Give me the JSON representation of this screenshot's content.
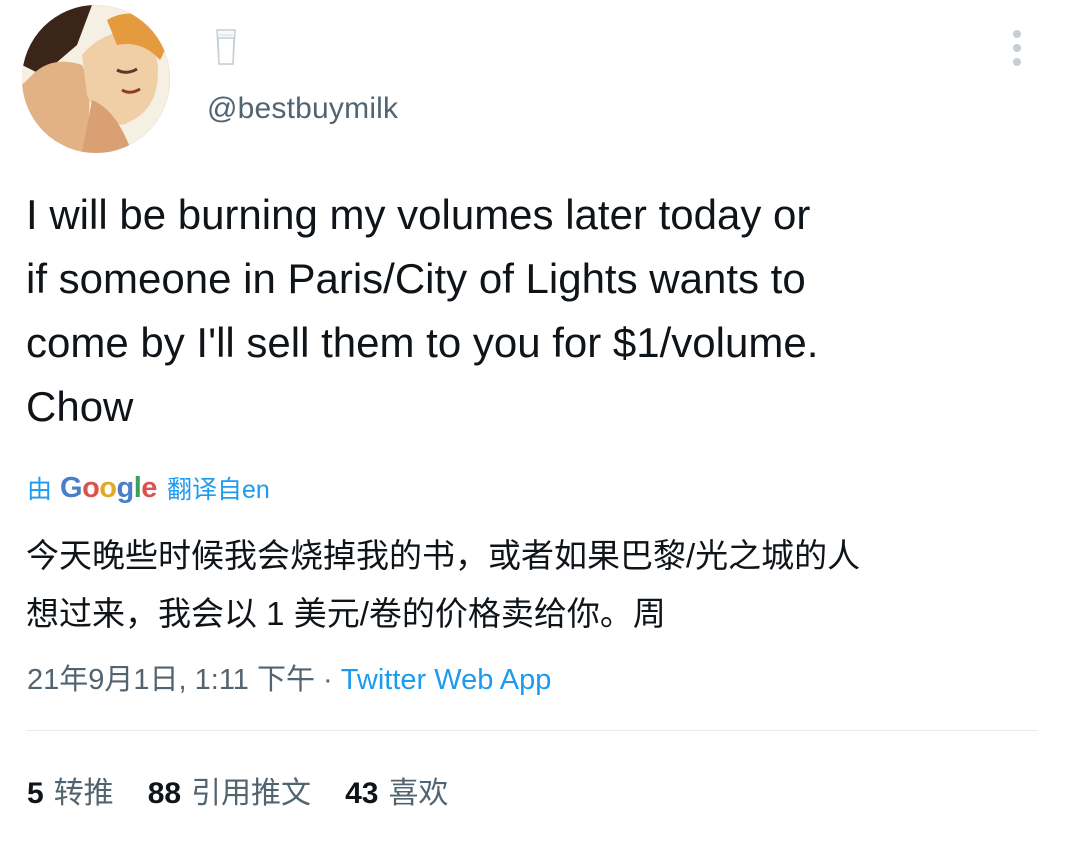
{
  "user": {
    "handle": "@bestbuymilk",
    "name_icon": "milk-glass-icon",
    "avatar": "avatar-image"
  },
  "tweet": {
    "lines": [
      "I will be burning my volumes later today or",
      "if someone in Paris/City of Lights wants to",
      "come by I'll sell them to you for $1/volume.",
      "Chow"
    ]
  },
  "translation": {
    "by_prefix": "由",
    "google_logo": "Google",
    "suffix": "翻译自en",
    "lines": [
      "今天晚些时候我会烧掉我的书，或者如果巴黎/光之城的人",
      "想过来，我会以 1 美元/卷的价格卖给你。周"
    ]
  },
  "meta": {
    "timestamp": "21年9月1日, 1:11 下午",
    "separator": "·",
    "source": "Twitter Web App"
  },
  "stats": [
    {
      "count": "5",
      "label": "转推"
    },
    {
      "count": "88",
      "label": "引用推文"
    },
    {
      "count": "43",
      "label": "喜欢"
    }
  ],
  "colors": {
    "link": "#1d9bf0",
    "secondary_text": "#536471",
    "primary_text": "#0f1419"
  }
}
